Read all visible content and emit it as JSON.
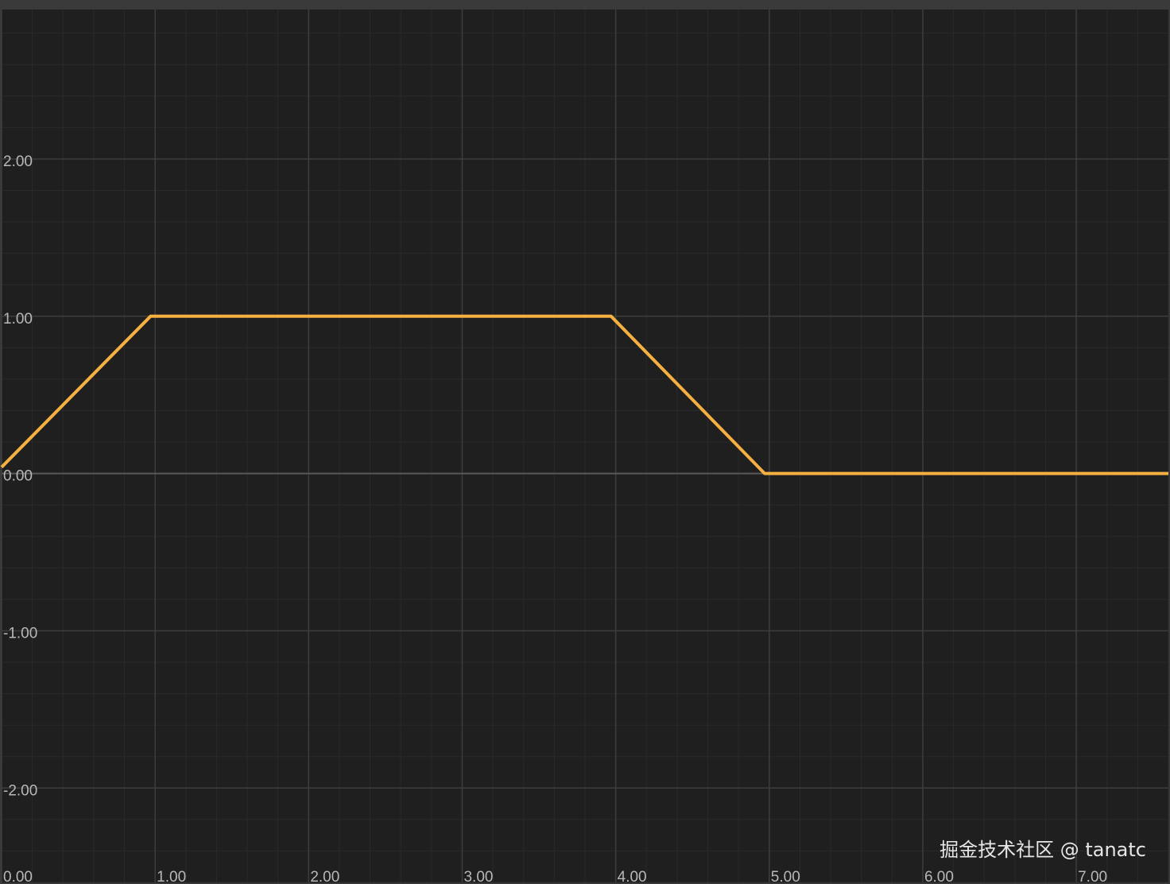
{
  "chart_data": {
    "type": "line",
    "title": "",
    "xlabel": "",
    "ylabel": "",
    "xlim": [
      0,
      7.6
    ],
    "ylim": [
      -2.6,
      2.95
    ],
    "x_ticks": [
      {
        "value": 0,
        "label": "0.00"
      },
      {
        "value": 1,
        "label": "1.00"
      },
      {
        "value": 2,
        "label": "2.00"
      },
      {
        "value": 3,
        "label": "3.00"
      },
      {
        "value": 4,
        "label": "4.00"
      },
      {
        "value": 5,
        "label": "5.00"
      },
      {
        "value": 6,
        "label": "6.00"
      },
      {
        "value": 7,
        "label": "7.00"
      }
    ],
    "y_ticks": [
      {
        "value": 2,
        "label": "2.00"
      },
      {
        "value": 1,
        "label": "1.00"
      },
      {
        "value": 0,
        "label": "0.00"
      },
      {
        "value": -1,
        "label": "-1.00"
      },
      {
        "value": -2,
        "label": "-2.00"
      }
    ],
    "grid": true,
    "minor_grid_step": 0.2,
    "series": [
      {
        "color": "#f5b041",
        "points": [
          {
            "x": 0,
            "y": 0.04
          },
          {
            "x": 0.97,
            "y": 1.0
          },
          {
            "x": 3.97,
            "y": 1.0
          },
          {
            "x": 4.97,
            "y": 0.0
          },
          {
            "x": 7.6,
            "y": 0.0
          }
        ]
      }
    ]
  },
  "colors": {
    "background": "#1f1f1f",
    "frame": "#3a3a3a",
    "major_grid": "#3d3d3d",
    "minor_grid": "#2a2a2a",
    "zero_line": "#595959",
    "tick_label": "#b8b8b8"
  },
  "watermark": {
    "text": "掘金技术社区 @ tanatc"
  }
}
